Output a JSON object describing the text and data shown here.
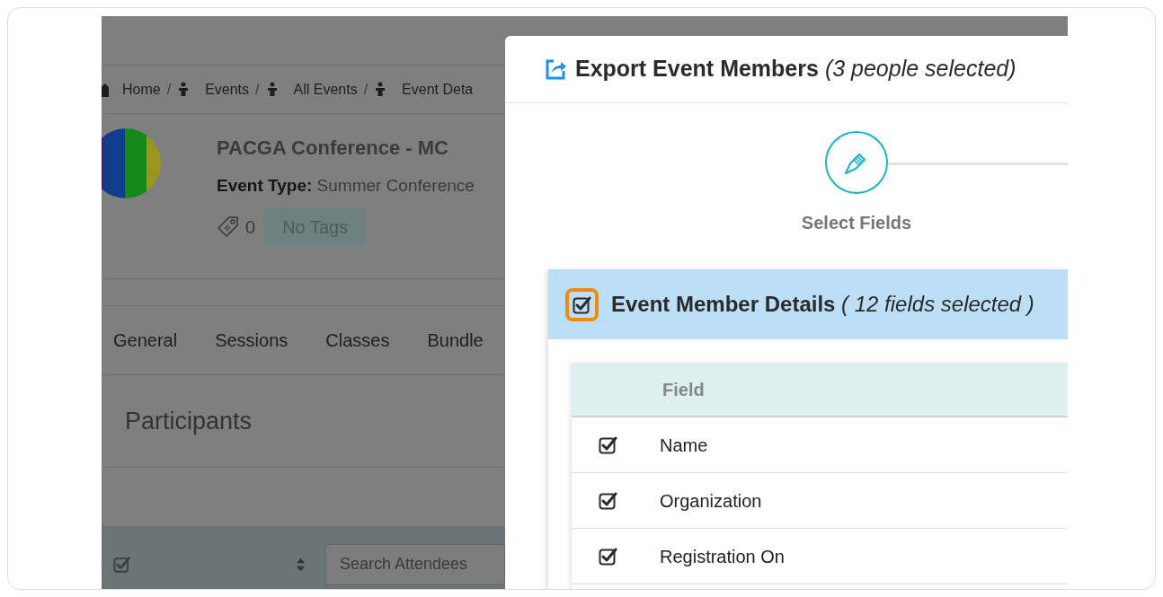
{
  "breadcrumb": [
    {
      "label": "Home"
    },
    {
      "separator": "/",
      "label": "Events"
    },
    {
      "separator": "/",
      "label": "All Events"
    },
    {
      "separator": "/",
      "label": "Event Deta"
    }
  ],
  "event": {
    "title": "PACGA Conference - MC",
    "type_label": "Event Type:",
    "type_value": "Summer Conference",
    "tag_count": "0",
    "tags_text": "No Tags"
  },
  "tabs": [
    {
      "label": "General"
    },
    {
      "label": "Sessions"
    },
    {
      "label": "Classes"
    },
    {
      "label": "Bundle"
    }
  ],
  "section_title": "Participants",
  "toolbar": {
    "select_all_checked": true,
    "search": {
      "placeholder": "Search Attendees"
    }
  },
  "modal": {
    "title": "**Export Event Members** *(3 people selected)*",
    "steps": [
      {
        "label": "Select Fields",
        "active": true
      }
    ],
    "group": {
      "title": "**Event Member Details** *( 12 fields selected )*",
      "checked": true,
      "highlighted": true,
      "columns": [
        "Field"
      ],
      "rows": [
        {
          "label": "Name",
          "checked": true
        },
        {
          "label": "Organization",
          "checked": true
        },
        {
          "label": "Registration On",
          "checked": true
        }
      ]
    }
  }
}
